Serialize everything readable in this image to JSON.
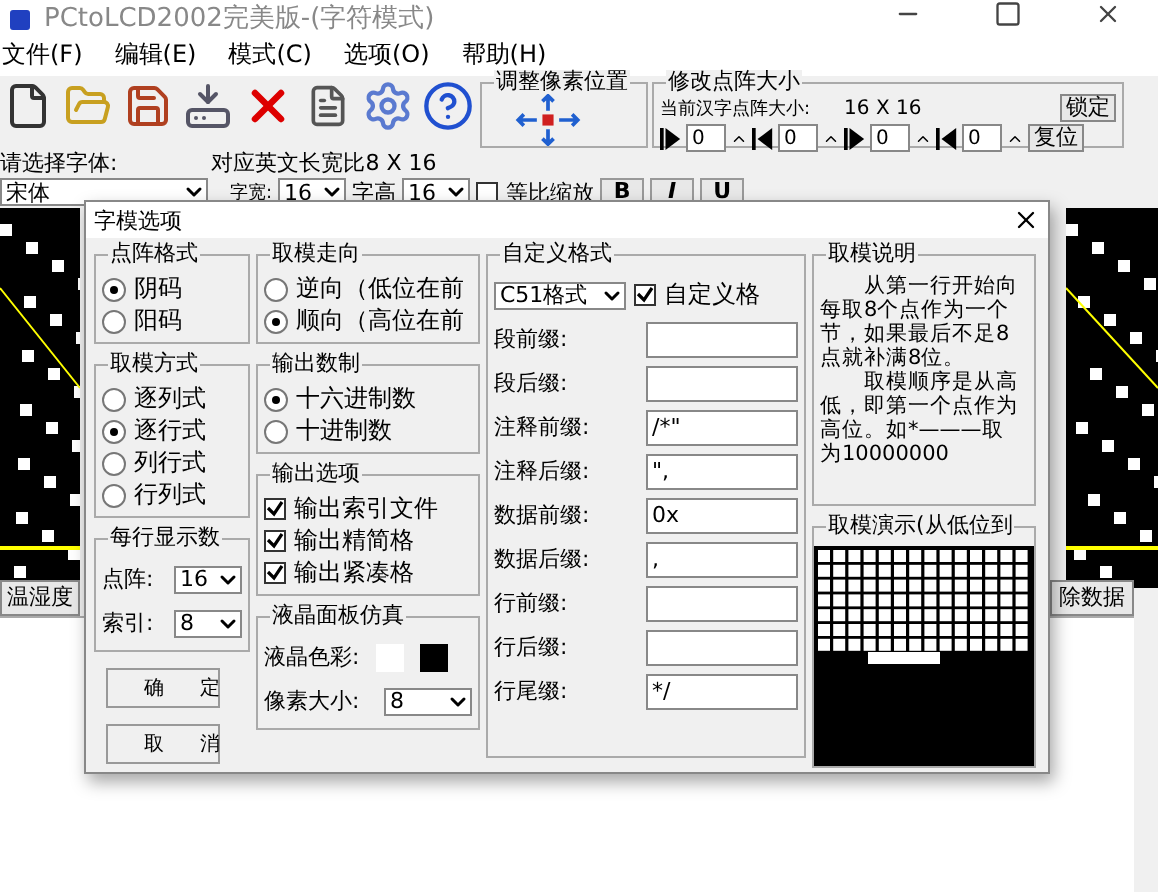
{
  "window": {
    "title": "PCtoLCD2002完美版-(字符模式)"
  },
  "menu": [
    "文件(F)",
    "编辑(E)",
    "模式(C)",
    "选项(O)",
    "帮助(H)"
  ],
  "pixel_adjust": {
    "title": "调整像素位置"
  },
  "matrix_size": {
    "title": "修改点阵大小",
    "current_label": "当前汉字点阵大小:",
    "current_value": "16 X 16",
    "lock_button": "锁定",
    "reset_button": "复位",
    "spinners": [
      "0",
      "0",
      "0",
      "0"
    ]
  },
  "font_label": "请选择字体:",
  "ratio": "对应英文长宽比8 X 16",
  "font": {
    "value": "宋体",
    "width_label": "字宽:",
    "width_value": "16",
    "height_label": "字高",
    "height_value": "16"
  },
  "proportional": {
    "label": "等比缩放",
    "checked": false
  },
  "style_buttons": [
    "B",
    "I",
    "U"
  ],
  "left_button": "温湿度",
  "clear_button": "除数据",
  "dialog": {
    "title": "字模选项",
    "dot_format": {
      "title": "点阵格式",
      "options": [
        {
          "label": "阴码",
          "selected": true
        },
        {
          "label": "阳码",
          "selected": false
        }
      ]
    },
    "scan_mode": {
      "title": "取模方式",
      "options": [
        {
          "label": "逐列式",
          "selected": false
        },
        {
          "label": "逐行式",
          "selected": true
        },
        {
          "label": "列行式",
          "selected": false
        },
        {
          "label": "行列式",
          "selected": false
        }
      ]
    },
    "per_line": {
      "title": "每行显示数",
      "dot_label": "点阵:",
      "dot_value": "16",
      "index_label": "索引:",
      "index_value": "8"
    },
    "buttons": [
      "确定",
      "取消"
    ],
    "direction": {
      "title": "取模走向",
      "options": [
        {
          "label": "逆向（低位在前",
          "selected": false
        },
        {
          "label": "顺向（高位在前",
          "selected": true
        }
      ]
    },
    "number_base": {
      "title": "输出数制",
      "options": [
        {
          "label": "十六进制数",
          "selected": true
        },
        {
          "label": "十进制数",
          "selected": false
        }
      ]
    },
    "output_options": {
      "title": "输出选项",
      "items": [
        {
          "label": "输出索引文件",
          "checked": true
        },
        {
          "label": "输出精简格",
          "checked": true
        },
        {
          "label": "输出紧凑格",
          "checked": true
        }
      ]
    },
    "lcd": {
      "title": "液晶面板仿真",
      "color_label": "液晶色彩:",
      "colors": [
        {
          "color": "#ffffff"
        },
        {
          "color": "#000000"
        }
      ],
      "pixel_label": "像素大小:",
      "pixel_value": "8"
    },
    "custom_format": {
      "title": "自定义格式",
      "preset": "C51格式",
      "custom": {
        "label": "自定义格",
        "checked": true
      },
      "fields": [
        {
          "label": "段前缀:"
        },
        {
          "label": "段后缀:"
        },
        {
          "label": "注释前缀:",
          "value": "/*\""
        },
        {
          "label": "注释后缀:",
          "value": "\","
        },
        {
          "label": "数据前缀:",
          "value": "0x"
        },
        {
          "label": "数据后缀:",
          "value": ","
        },
        {
          "label": "行前缀:"
        },
        {
          "label": "行后缀:"
        },
        {
          "label": "行尾缀:",
          "value": "*/"
        }
      ]
    },
    "description": {
      "title": "取模说明",
      "lines": [
        "　　从第一行开始向",
        "每取8个点作为一个",
        "节，如果最后不足8",
        "点就补满8位。",
        "　　取模顺序是从高",
        "低，即第一个点作为",
        "高位。如*———取",
        "为10000000"
      ]
    },
    "demo": {
      "title": "取模演示(从低位到"
    }
  }
}
